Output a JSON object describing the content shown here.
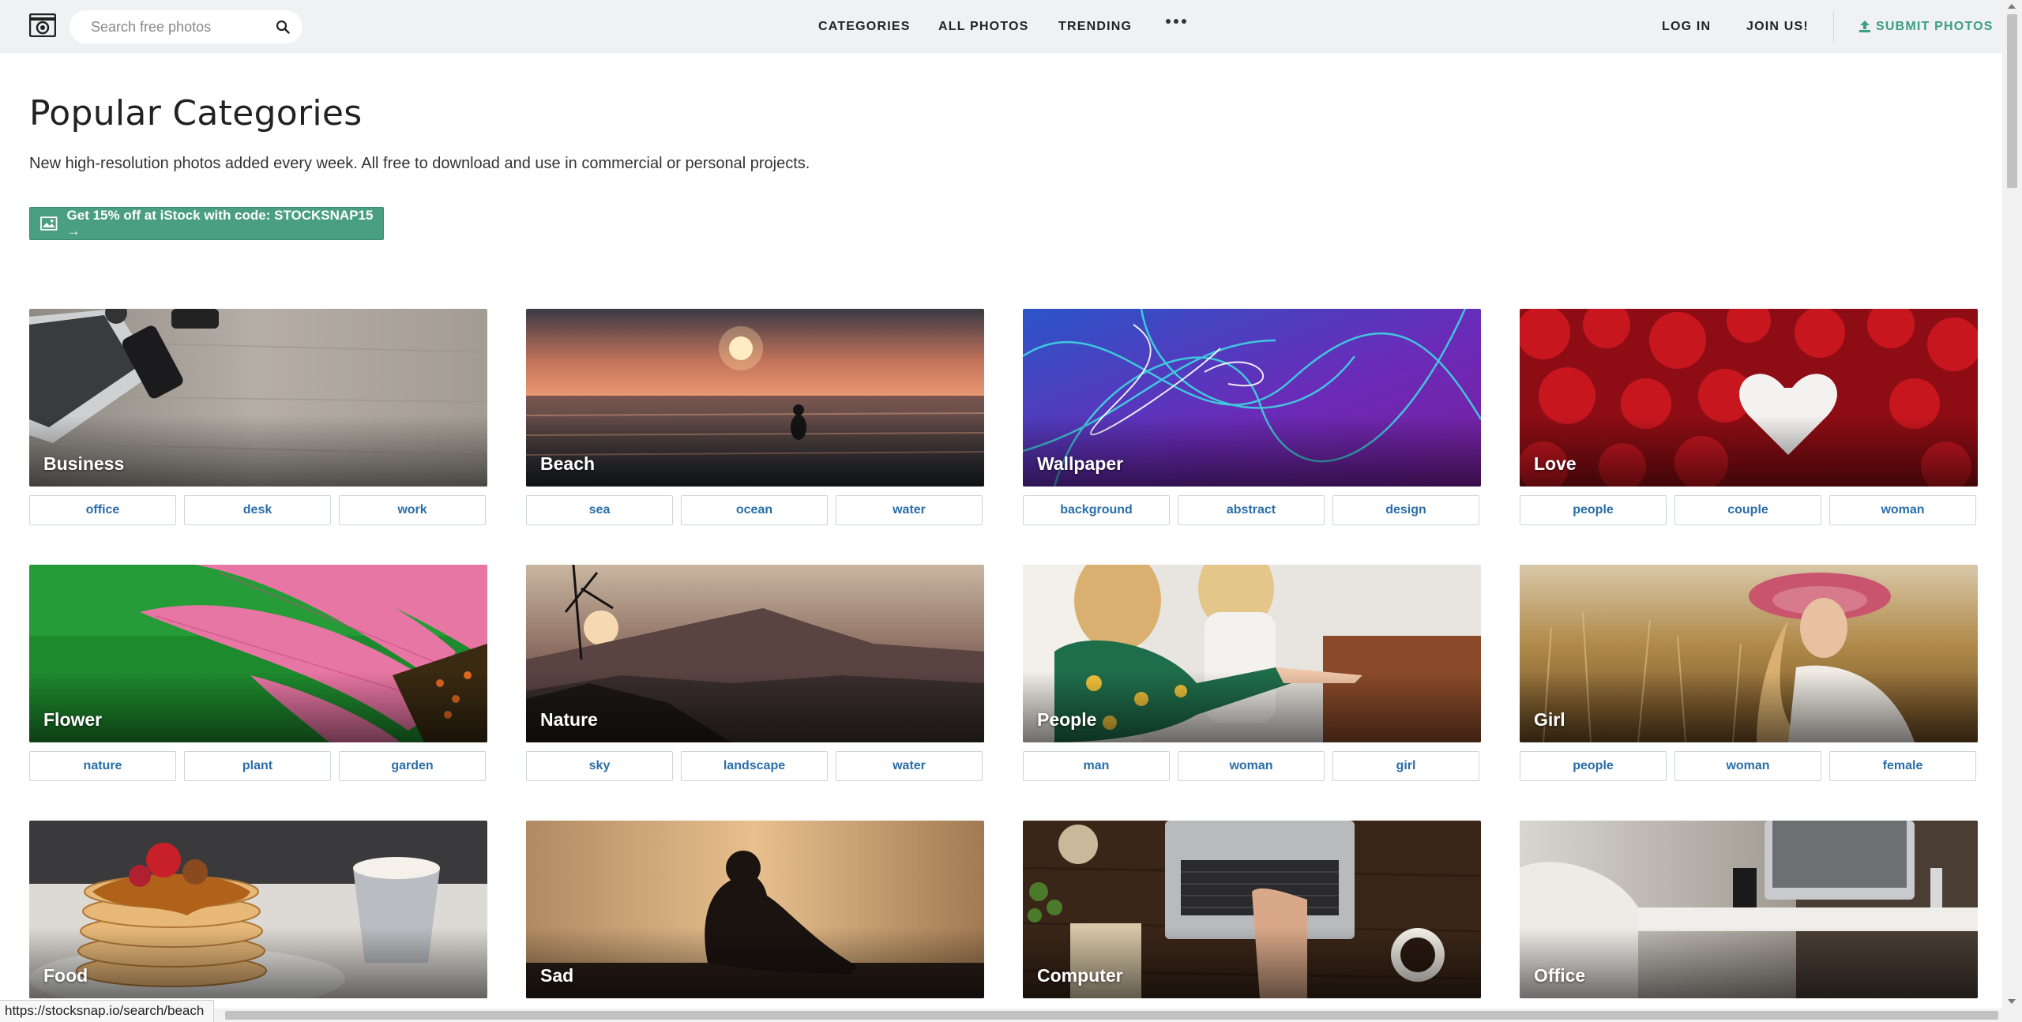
{
  "header": {
    "search_placeholder": "Search free photos",
    "nav": {
      "categories": "CATEGORIES",
      "all_photos": "ALL PHOTOS",
      "trending": "TRENDING",
      "more": "more-dots-icon"
    },
    "login": "LOG IN",
    "join": "JOIN US!",
    "submit": "SUBMIT PHOTOS"
  },
  "main": {
    "title": "Popular Categories",
    "subtitle": "New high-resolution photos added every week. All free to download and use in commercial or personal projects.",
    "promo": "Get 15% off at iStock with code: STOCKSNAP15 →"
  },
  "categories": [
    {
      "name": "Business",
      "tags": [
        "office",
        "desk",
        "work"
      ]
    },
    {
      "name": "Beach",
      "tags": [
        "sea",
        "ocean",
        "water"
      ]
    },
    {
      "name": "Wallpaper",
      "tags": [
        "background",
        "abstract",
        "design"
      ]
    },
    {
      "name": "Love",
      "tags": [
        "people",
        "couple",
        "woman"
      ]
    },
    {
      "name": "Flower",
      "tags": [
        "nature",
        "plant",
        "garden"
      ]
    },
    {
      "name": "Nature",
      "tags": [
        "sky",
        "landscape",
        "water"
      ]
    },
    {
      "name": "People",
      "tags": [
        "man",
        "woman",
        "girl"
      ]
    },
    {
      "name": "Girl",
      "tags": [
        "people",
        "woman",
        "female"
      ]
    },
    {
      "name": "Food",
      "tags": []
    },
    {
      "name": "Sad",
      "tags": []
    },
    {
      "name": "Computer",
      "tags": []
    },
    {
      "name": "Office",
      "tags": []
    }
  ],
  "status_url": "https://stocksnap.io/search/beach",
  "colors": {
    "header_bg": "#f0f1f2",
    "accent_green": "#4a9e82",
    "submit_green": "#3a9e82",
    "tag_blue": "#2a6ea8"
  }
}
